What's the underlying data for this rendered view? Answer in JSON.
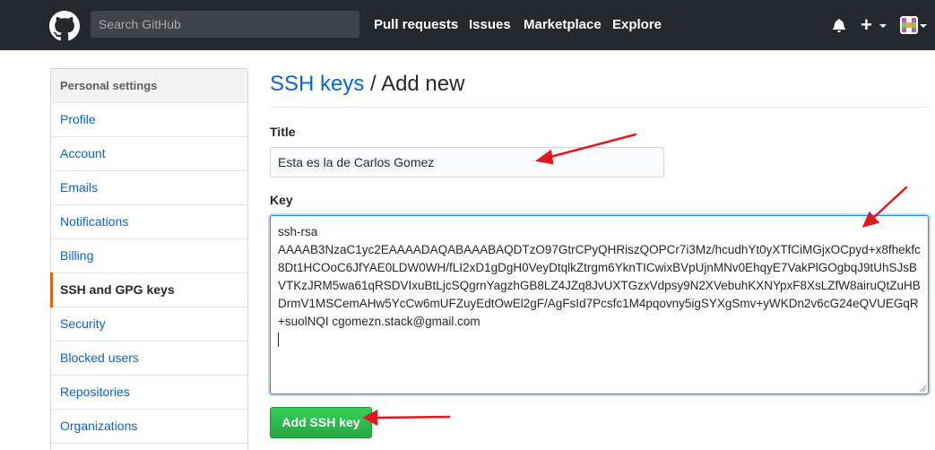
{
  "header": {
    "search_placeholder": "Search GitHub",
    "nav": [
      "Pull requests",
      "Issues",
      "Marketplace",
      "Explore"
    ],
    "icons": [
      "github-mark-icon",
      "bell-icon",
      "plus-icon",
      "avatar"
    ]
  },
  "sidebar": {
    "heading": "Personal settings",
    "items": [
      {
        "label": "Profile"
      },
      {
        "label": "Account"
      },
      {
        "label": "Emails"
      },
      {
        "label": "Notifications"
      },
      {
        "label": "Billing"
      },
      {
        "label": "SSH and GPG keys",
        "active": true
      },
      {
        "label": "Security"
      },
      {
        "label": "Blocked users"
      },
      {
        "label": "Repositories"
      },
      {
        "label": "Organizations"
      }
    ]
  },
  "main": {
    "title_link": "SSH keys",
    "title_sep": " / ",
    "title_rest": "Add new",
    "title_label": "Title",
    "title_value": "Esta es la de Carlos Gomez",
    "key_label": "Key",
    "key_value": "ssh-rsa\nAAAAB3NzaC1yc2EAAAADAQABAAABAQDTzO97GtrCPyQHRiszQOPCr7i3Mz/hcudhYt0yXTfCiMGjxOCpyd+x8fhekfc8Dt1HCOoC6JfYAE0LDW0WH/fLI2xD1gDgH0VeyDtqlkZtrgm6YknTICwixBVpUjnMNv0EhqyE7VakPlGOgbqJ9tUhSJsBVTKzJRM5wa61qRSDVIxuBtLjcSQgrnYagzhGB8LZ4JZq8JvUXTGzxVdpsy9N2XVebuhKXNYpxF8XsLZfW8airuQtZuHBDrmV1MSCemAHw5YcCw6mUFZuyEdtOwEl2gF/AgFsId7Pcsfc1M4pqovny5igSYXgSmv+yWKDn2v6cG24eQVUEGqR+suolNQI cgomezn.stack@gmail.com",
    "submit_label": "Add SSH key"
  },
  "colors": {
    "header_bg": "#24292e",
    "link": "#0366d6",
    "active_marker": "#e36209",
    "button": "#28a745",
    "annotation_arrow": "#e0191f"
  }
}
